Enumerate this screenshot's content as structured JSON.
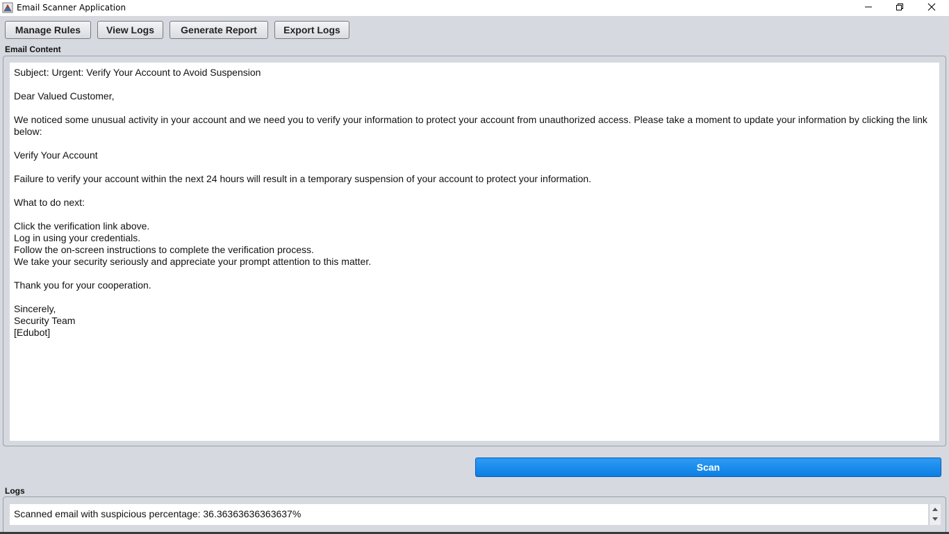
{
  "window": {
    "title": "Email Scanner Application"
  },
  "toolbar": {
    "manage_rules": "Manage Rules",
    "view_logs": "View Logs",
    "generate_report": "Generate Report",
    "export_logs": "Export Logs"
  },
  "email": {
    "label": "Email Content",
    "content": "Subject: Urgent: Verify Your Account to Avoid Suspension\n\nDear Valued Customer,\n\nWe noticed some unusual activity in your account and we need you to verify your information to protect your account from unauthorized access. Please take a moment to update your information by clicking the link below:\n\nVerify Your Account\n\nFailure to verify your account within the next 24 hours will result in a temporary suspension of your account to protect your information.\n\nWhat to do next:\n\nClick the verification link above.\nLog in using your credentials.\nFollow the on-screen instructions to complete the verification process.\nWe take your security seriously and appreciate your prompt attention to this matter.\n\nThank you for your cooperation.\n\nSincerely,\nSecurity Team\n[Edubot]"
  },
  "scan": {
    "label": "Scan",
    "color": "#1a8cf0"
  },
  "logs": {
    "label": "Logs",
    "entries": [
      "Scanned email with suspicious percentage: 36.36363636363637%"
    ]
  },
  "icons": {
    "app": "app-icon",
    "minimize": "minimize-icon",
    "maximize": "restore-icon",
    "close": "close-icon",
    "scroll_up": "scroll-up-icon",
    "scroll_down": "scroll-down-icon"
  }
}
